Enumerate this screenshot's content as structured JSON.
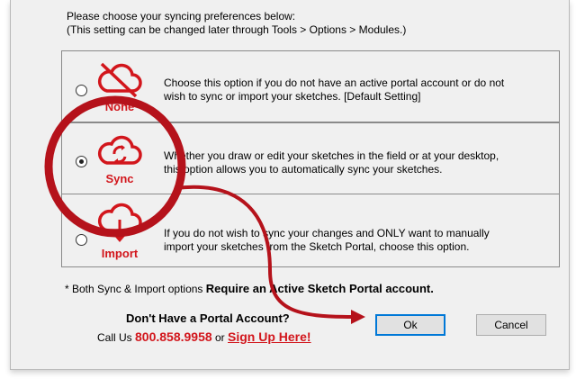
{
  "intro": {
    "line1": "Please choose your syncing preferences below:",
    "line2": "(This setting can be changed later through Tools > Options > Modules.)"
  },
  "options": [
    {
      "label": "None",
      "selected": false,
      "icon": "cloud-off-icon",
      "text1": "Choose this option if you do not have an active portal account or do not",
      "text2": "wish to sync or import your sketches. [Default Setting]"
    },
    {
      "label": "Sync",
      "selected": true,
      "icon": "cloud-sync-icon",
      "text1": "Whether you draw or edit your sketches in the field or at your desktop,",
      "text2": "this option allows you to automatically sync your sketches."
    },
    {
      "label": "Import",
      "selected": false,
      "icon": "cloud-download-icon",
      "text1": "If you do not wish to sync your changes and ONLY want to manually",
      "text2": "import your sketches from the Sketch Portal, choose this option."
    }
  ],
  "footnote": {
    "prefix": "* Both Sync & Import options",
    "bold": "Require an Active Sketch Portal account."
  },
  "account": {
    "question": "Don't Have a Portal Account?",
    "call_prefix": "Call Us",
    "phone": "800.858.9958",
    "or": "or",
    "signup": "Sign Up Here!"
  },
  "buttons": {
    "ok": "Ok",
    "cancel": "Cancel"
  },
  "colors": {
    "accent_red": "#d2161c",
    "highlight_red": "#b5121b",
    "ok_border": "#0078d7"
  }
}
